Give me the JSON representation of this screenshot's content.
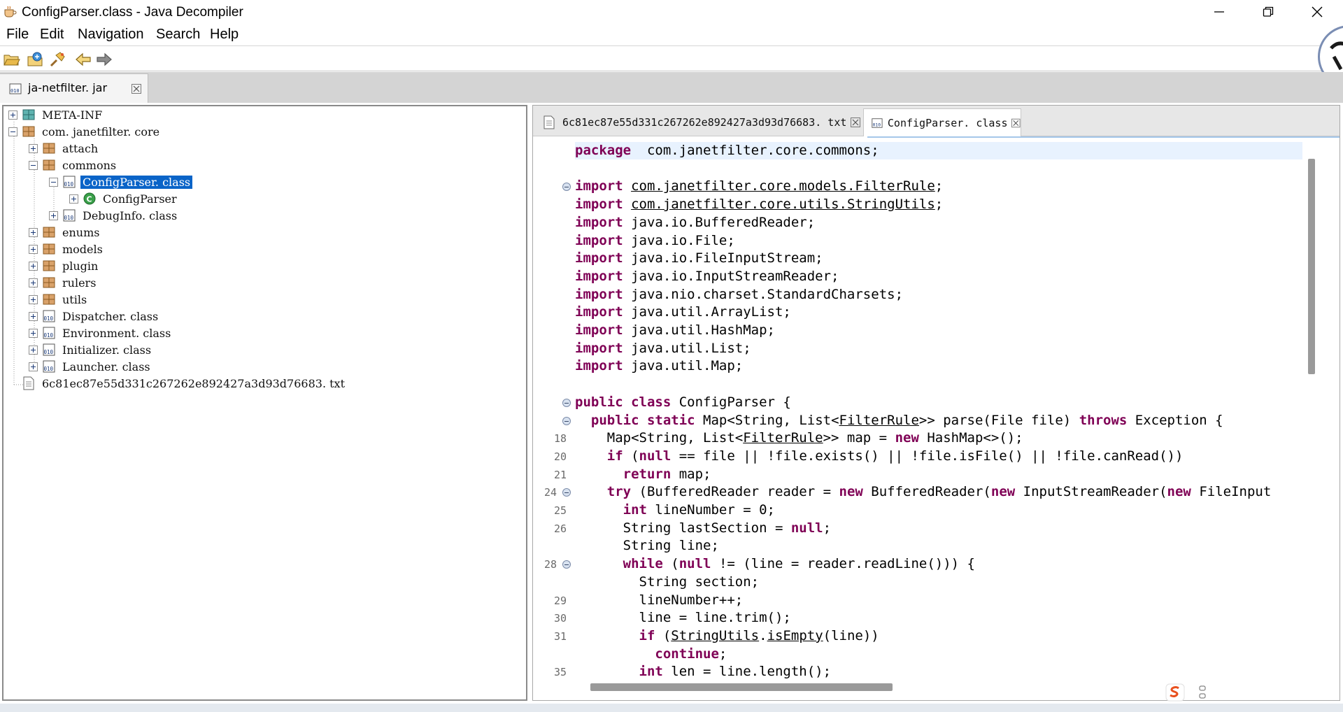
{
  "window": {
    "title": "ConfigParser.class - Java Decompiler",
    "minimize_icon": "minimize-icon",
    "maximize_icon": "restore-icon",
    "close_icon": "close-icon"
  },
  "menu": [
    "File",
    "Edit",
    "Navigation",
    "Search",
    "Help"
  ],
  "toolbar": {
    "icons": [
      "open-file-icon",
      "open-type-icon",
      "search-icon",
      "back-icon",
      "forward-icon"
    ]
  },
  "outer_tab": {
    "label": "ja-netfilter. jar",
    "icon": "jar-icon"
  },
  "tree": [
    {
      "label": "META-INF",
      "icon": "folder-package-icon",
      "expander": "plus",
      "level": 0
    },
    {
      "label": "com. janetfilter. core",
      "icon": "package-icon",
      "expander": "minus",
      "level": 0
    },
    {
      "label": "attach",
      "icon": "package-icon",
      "expander": "plus",
      "level": 1
    },
    {
      "label": "commons",
      "icon": "package-icon",
      "expander": "minus",
      "level": 1
    },
    {
      "label": "ConfigParser. class",
      "icon": "class-file-icon",
      "expander": "minus",
      "level": 2,
      "selected": true
    },
    {
      "label": "ConfigParser",
      "icon": "class-icon",
      "expander": "plus",
      "level": 3
    },
    {
      "label": "DebugInfo. class",
      "icon": "class-file-icon",
      "expander": "plus",
      "level": 2
    },
    {
      "label": "enums",
      "icon": "package-icon",
      "expander": "plus",
      "level": 1
    },
    {
      "label": "models",
      "icon": "package-icon",
      "expander": "plus",
      "level": 1
    },
    {
      "label": "plugin",
      "icon": "package-icon",
      "expander": "plus",
      "level": 1
    },
    {
      "label": "rulers",
      "icon": "package-icon",
      "expander": "plus",
      "level": 1
    },
    {
      "label": "utils",
      "icon": "package-icon",
      "expander": "plus",
      "level": 1
    },
    {
      "label": "Dispatcher. class",
      "icon": "class-file-icon",
      "expander": "plus",
      "level": 1
    },
    {
      "label": "Environment. class",
      "icon": "class-file-icon",
      "expander": "plus",
      "level": 1
    },
    {
      "label": "Initializer. class",
      "icon": "class-file-icon",
      "expander": "plus",
      "level": 1
    },
    {
      "label": "Launcher. class",
      "icon": "class-file-icon",
      "expander": "plus",
      "level": 1
    },
    {
      "label": "6c81ec87e55d331c267262e892427a3d93d76683. txt",
      "icon": "text-file-icon",
      "expander": "none",
      "level": 0
    }
  ],
  "editor_tabs": [
    {
      "label": "6c81ec87e55d331c267262e892427a3d93d76683. txt",
      "icon": "text-file-icon",
      "active": false
    },
    {
      "label": "ConfigParser. class",
      "icon": "class-file-icon",
      "active": true
    }
  ],
  "code": [
    {
      "ln": "",
      "fold": false,
      "tokens": [
        [
          "kw",
          "package"
        ],
        [
          "",
          "  com.janetfilter.core.commons;"
        ]
      ]
    },
    {
      "ln": "",
      "fold": false,
      "tokens": []
    },
    {
      "ln": "",
      "fold": true,
      "tokens": [
        [
          "kw",
          "import"
        ],
        [
          "",
          " "
        ],
        [
          "ul",
          "com.janetfilter.core.models.FilterRule"
        ],
        [
          "",
          ";"
        ]
      ]
    },
    {
      "ln": "",
      "fold": false,
      "tokens": [
        [
          "kw",
          "import"
        ],
        [
          "",
          " "
        ],
        [
          "ul",
          "com.janetfilter.core.utils.StringUtils"
        ],
        [
          "",
          ";"
        ]
      ]
    },
    {
      "ln": "",
      "fold": false,
      "tokens": [
        [
          "kw",
          "import"
        ],
        [
          "",
          " java.io.BufferedReader;"
        ]
      ]
    },
    {
      "ln": "",
      "fold": false,
      "tokens": [
        [
          "kw",
          "import"
        ],
        [
          "",
          " java.io.File;"
        ]
      ]
    },
    {
      "ln": "",
      "fold": false,
      "tokens": [
        [
          "kw",
          "import"
        ],
        [
          "",
          " java.io.FileInputStream;"
        ]
      ]
    },
    {
      "ln": "",
      "fold": false,
      "tokens": [
        [
          "kw",
          "import"
        ],
        [
          "",
          " java.io.InputStreamReader;"
        ]
      ]
    },
    {
      "ln": "",
      "fold": false,
      "tokens": [
        [
          "kw",
          "import"
        ],
        [
          "",
          " java.nio.charset.StandardCharsets;"
        ]
      ]
    },
    {
      "ln": "",
      "fold": false,
      "tokens": [
        [
          "kw",
          "import"
        ],
        [
          "",
          " java.util.ArrayList;"
        ]
      ]
    },
    {
      "ln": "",
      "fold": false,
      "tokens": [
        [
          "kw",
          "import"
        ],
        [
          "",
          " java.util.HashMap;"
        ]
      ]
    },
    {
      "ln": "",
      "fold": false,
      "tokens": [
        [
          "kw",
          "import"
        ],
        [
          "",
          " java.util.List;"
        ]
      ]
    },
    {
      "ln": "",
      "fold": false,
      "tokens": [
        [
          "kw",
          "import"
        ],
        [
          "",
          " java.util.Map;"
        ]
      ]
    },
    {
      "ln": "",
      "fold": false,
      "tokens": []
    },
    {
      "ln": "",
      "fold": true,
      "tokens": [
        [
          "kw",
          "public class"
        ],
        [
          "",
          " ConfigParser {"
        ]
      ]
    },
    {
      "ln": "",
      "fold": true,
      "tokens": [
        [
          "",
          "  "
        ],
        [
          "kw",
          "public static"
        ],
        [
          "",
          " Map<String, List<"
        ],
        [
          "ul",
          "FilterRule"
        ],
        [
          "",
          ">> parse(File file) "
        ],
        [
          "kw",
          "throws"
        ],
        [
          "",
          " Exception {"
        ]
      ]
    },
    {
      "ln": "18",
      "fold": false,
      "tokens": [
        [
          "",
          "    Map<String, List<"
        ],
        [
          "ul",
          "FilterRule"
        ],
        [
          "",
          ">> map = "
        ],
        [
          "kw",
          "new"
        ],
        [
          "",
          " HashMap<>();"
        ]
      ]
    },
    {
      "ln": "20",
      "fold": false,
      "tokens": [
        [
          "",
          "    "
        ],
        [
          "kw",
          "if"
        ],
        [
          "",
          " ("
        ],
        [
          "kw",
          "null"
        ],
        [
          "",
          " == file || !file.exists() || !file.isFile() || !file.canRead())"
        ]
      ]
    },
    {
      "ln": "21",
      "fold": false,
      "tokens": [
        [
          "",
          "      "
        ],
        [
          "kw",
          "return"
        ],
        [
          "",
          " map;"
        ]
      ]
    },
    {
      "ln": "24",
      "fold": true,
      "tokens": [
        [
          "",
          "    "
        ],
        [
          "kw",
          "try"
        ],
        [
          "",
          " (BufferedReader reader = "
        ],
        [
          "kw",
          "new"
        ],
        [
          "",
          " BufferedReader("
        ],
        [
          "kw",
          "new"
        ],
        [
          "",
          " InputStreamReader("
        ],
        [
          "kw",
          "new"
        ],
        [
          "",
          " FileInput"
        ]
      ]
    },
    {
      "ln": "25",
      "fold": false,
      "tokens": [
        [
          "",
          "      "
        ],
        [
          "kw",
          "int"
        ],
        [
          "",
          " lineNumber = 0;"
        ]
      ]
    },
    {
      "ln": "26",
      "fold": false,
      "tokens": [
        [
          "",
          "      String lastSection = "
        ],
        [
          "kw",
          "null"
        ],
        [
          "",
          ";"
        ]
      ]
    },
    {
      "ln": "",
      "fold": false,
      "tokens": [
        [
          "",
          "      String line;"
        ]
      ]
    },
    {
      "ln": "28",
      "fold": true,
      "tokens": [
        [
          "",
          "      "
        ],
        [
          "kw",
          "while"
        ],
        [
          "",
          " ("
        ],
        [
          "kw",
          "null"
        ],
        [
          "",
          " != (line = reader.readLine())) {"
        ]
      ]
    },
    {
      "ln": "",
      "fold": false,
      "tokens": [
        [
          "",
          "        String section;"
        ]
      ]
    },
    {
      "ln": "29",
      "fold": false,
      "tokens": [
        [
          "",
          "        lineNumber++;"
        ]
      ]
    },
    {
      "ln": "30",
      "fold": false,
      "tokens": [
        [
          "",
          "        line = line.trim();"
        ]
      ]
    },
    {
      "ln": "31",
      "fold": false,
      "tokens": [
        [
          "",
          "        "
        ],
        [
          "kw",
          "if"
        ],
        [
          "",
          " ("
        ],
        [
          "ul",
          "StringUtils"
        ],
        [
          "",
          "."
        ],
        [
          "ul",
          "isEmpty"
        ],
        [
          "",
          "(line))"
        ]
      ]
    },
    {
      "ln": "",
      "fold": false,
      "tokens": [
        [
          "",
          "          "
        ],
        [
          "kw",
          "continue"
        ],
        [
          "",
          ";"
        ]
      ]
    },
    {
      "ln": "35",
      "fold": false,
      "tokens": [
        [
          "",
          "        "
        ],
        [
          "kw",
          "int"
        ],
        [
          "",
          " len = line.length();"
        ]
      ]
    }
  ],
  "tray": {
    "ime_icon": "sogou-ime-icon"
  }
}
